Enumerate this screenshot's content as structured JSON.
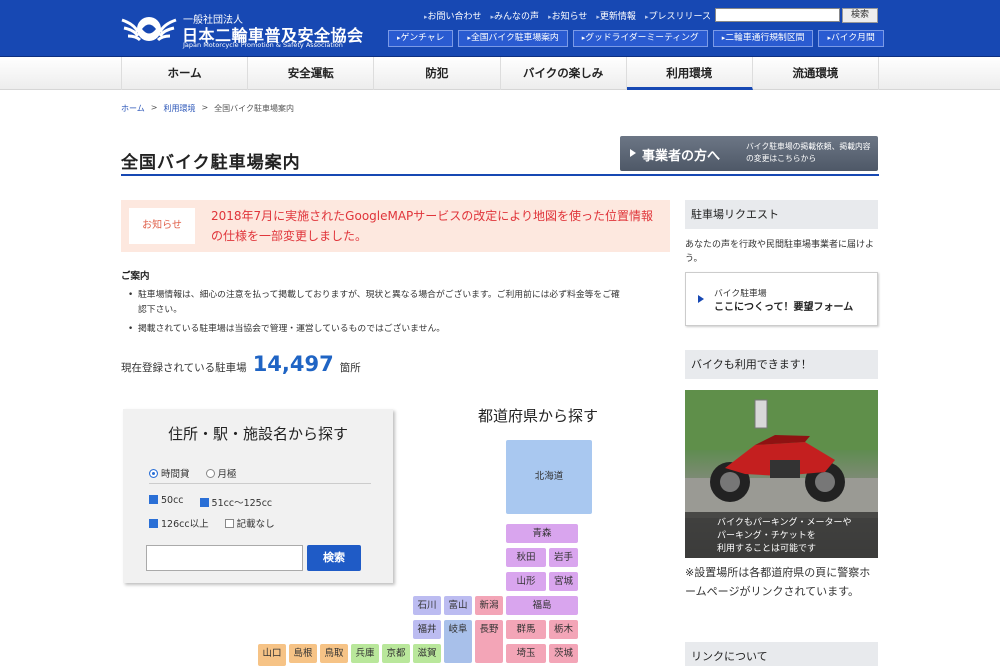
{
  "header": {
    "org_small": "一般社団法人",
    "org_name": "日本二輪車普及安全協会",
    "org_eng": "Japan Motorcycle Promotion & Safety Association",
    "top_links": [
      "お問い合わせ",
      "みんなの声",
      "お知らせ",
      "更新情報",
      "プレスリリース"
    ],
    "search_label": "検索",
    "sub_links": [
      "ゲンチャレ",
      "全国バイク駐車場案内",
      "グッドライダーミーティング",
      "二輪車通行規制区間",
      "バイク月間"
    ]
  },
  "nav": {
    "tabs": [
      "ホーム",
      "安全運転",
      "防犯",
      "バイクの楽しみ",
      "利用環境",
      "流通環境"
    ],
    "active": "利用環境"
  },
  "breadcrumb": {
    "items": [
      "ホーム",
      "利用環境",
      "全国バイク駐車場案内"
    ],
    "sep": ">"
  },
  "page": {
    "title": "全国バイク駐車場案内",
    "biz_button": {
      "main": "事業者の方へ",
      "sub": "バイク駐車場の掲載依頼、掲載内容の変更はこちらから"
    }
  },
  "notice": {
    "badge": "お知らせ",
    "text": "2018年7月に実施されたGoogleMAPサービスの改定により地図を使った位置情報の仕様を一部変更しました。"
  },
  "guide": {
    "heading": "ご案内",
    "items": [
      "駐車場情報は、細心の注意を払って掲載しておりますが、現状と異なる場合がございます。ご利用前には必ず料金等をご確認下さい。",
      "掲載されている駐車場は当協会で管理・運営しているものではございません。"
    ]
  },
  "count": {
    "prefix": "現在登録されている駐車場",
    "value": "14,497",
    "suffix": "箇所"
  },
  "search_panel": {
    "title": "住所・駅・施設名から探す",
    "radios": [
      {
        "label": "時間貸",
        "checked": true
      },
      {
        "label": "月極",
        "checked": false
      }
    ],
    "checks_row1": [
      {
        "label": "50cc",
        "checked": true
      },
      {
        "label": "51cc〜125cc",
        "checked": true
      }
    ],
    "checks_row2": [
      {
        "label": "126cc以上",
        "checked": true
      },
      {
        "label": "記載なし",
        "checked": false
      }
    ],
    "input_value": "",
    "button": "検索"
  },
  "pref_map": {
    "title": "都道府県から探す",
    "colors": {
      "hokkaido": "#a9c8f0",
      "tohoku": "#d9a5ee",
      "kanto": "#f3a5b7",
      "chubu_north": "#bcbcf1",
      "chubu": "#a8c0ea",
      "kinki": "#b9e79b",
      "chugoku": "#f6c386"
    },
    "prefectures": [
      {
        "name": "北海道",
        "region": "hokkaido"
      },
      {
        "name": "青森",
        "region": "tohoku"
      },
      {
        "name": "秋田",
        "region": "tohoku"
      },
      {
        "name": "岩手",
        "region": "tohoku"
      },
      {
        "name": "山形",
        "region": "tohoku"
      },
      {
        "name": "宮城",
        "region": "tohoku"
      },
      {
        "name": "石川",
        "region": "chubu_north"
      },
      {
        "name": "富山",
        "region": "chubu_north"
      },
      {
        "name": "新潟",
        "region": "kanto"
      },
      {
        "name": "福島",
        "region": "tohoku"
      },
      {
        "name": "福井",
        "region": "chubu_north"
      },
      {
        "name": "岐阜",
        "region": "chubu"
      },
      {
        "name": "長野",
        "region": "kanto"
      },
      {
        "name": "群馬",
        "region": "kanto"
      },
      {
        "name": "栃木",
        "region": "kanto"
      },
      {
        "name": "山口",
        "region": "chugoku"
      },
      {
        "name": "島根",
        "region": "chugoku"
      },
      {
        "name": "鳥取",
        "region": "chugoku"
      },
      {
        "name": "兵庫",
        "region": "kinki"
      },
      {
        "name": "京都",
        "region": "kinki"
      },
      {
        "name": "滋賀",
        "region": "kinki"
      },
      {
        "name": "埼玉",
        "region": "kanto"
      },
      {
        "name": "茨城",
        "region": "kanto"
      }
    ]
  },
  "sidebar": {
    "request": {
      "heading": "駐車場リクエスト",
      "text": "あなたの声を行政や民間駐車場事業者に届けよう。",
      "card_line1": "バイク駐車場",
      "card_line2": "ここにつくって！要望フォーム"
    },
    "bike": {
      "heading": "バイクも利用できます！",
      "caption": [
        "バイクもパーキング・メーターや",
        "パーキング・チケットを",
        "利用することは可能です"
      ],
      "note": "※設置場所は各都道府県の頁に警察ホームページがリンクされています。"
    },
    "links_heading": "リンクについて"
  }
}
